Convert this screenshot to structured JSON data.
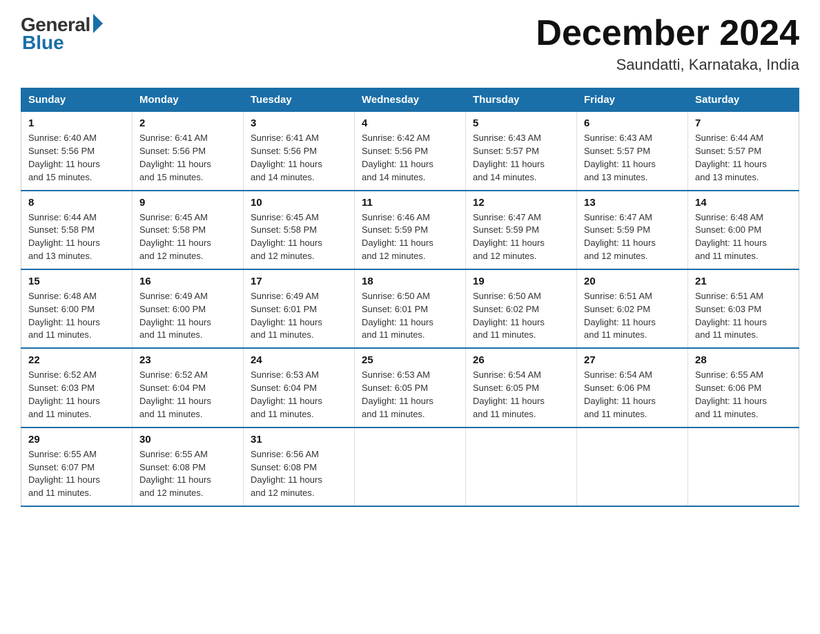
{
  "logo": {
    "general": "General",
    "blue": "Blue"
  },
  "title": "December 2024",
  "subtitle": "Saundatti, Karnataka, India",
  "days_of_week": [
    "Sunday",
    "Monday",
    "Tuesday",
    "Wednesday",
    "Thursday",
    "Friday",
    "Saturday"
  ],
  "weeks": [
    [
      {
        "day": "1",
        "info": "Sunrise: 6:40 AM\nSunset: 5:56 PM\nDaylight: 11 hours\nand 15 minutes."
      },
      {
        "day": "2",
        "info": "Sunrise: 6:41 AM\nSunset: 5:56 PM\nDaylight: 11 hours\nand 15 minutes."
      },
      {
        "day": "3",
        "info": "Sunrise: 6:41 AM\nSunset: 5:56 PM\nDaylight: 11 hours\nand 14 minutes."
      },
      {
        "day": "4",
        "info": "Sunrise: 6:42 AM\nSunset: 5:56 PM\nDaylight: 11 hours\nand 14 minutes."
      },
      {
        "day": "5",
        "info": "Sunrise: 6:43 AM\nSunset: 5:57 PM\nDaylight: 11 hours\nand 14 minutes."
      },
      {
        "day": "6",
        "info": "Sunrise: 6:43 AM\nSunset: 5:57 PM\nDaylight: 11 hours\nand 13 minutes."
      },
      {
        "day": "7",
        "info": "Sunrise: 6:44 AM\nSunset: 5:57 PM\nDaylight: 11 hours\nand 13 minutes."
      }
    ],
    [
      {
        "day": "8",
        "info": "Sunrise: 6:44 AM\nSunset: 5:58 PM\nDaylight: 11 hours\nand 13 minutes."
      },
      {
        "day": "9",
        "info": "Sunrise: 6:45 AM\nSunset: 5:58 PM\nDaylight: 11 hours\nand 12 minutes."
      },
      {
        "day": "10",
        "info": "Sunrise: 6:45 AM\nSunset: 5:58 PM\nDaylight: 11 hours\nand 12 minutes."
      },
      {
        "day": "11",
        "info": "Sunrise: 6:46 AM\nSunset: 5:59 PM\nDaylight: 11 hours\nand 12 minutes."
      },
      {
        "day": "12",
        "info": "Sunrise: 6:47 AM\nSunset: 5:59 PM\nDaylight: 11 hours\nand 12 minutes."
      },
      {
        "day": "13",
        "info": "Sunrise: 6:47 AM\nSunset: 5:59 PM\nDaylight: 11 hours\nand 12 minutes."
      },
      {
        "day": "14",
        "info": "Sunrise: 6:48 AM\nSunset: 6:00 PM\nDaylight: 11 hours\nand 11 minutes."
      }
    ],
    [
      {
        "day": "15",
        "info": "Sunrise: 6:48 AM\nSunset: 6:00 PM\nDaylight: 11 hours\nand 11 minutes."
      },
      {
        "day": "16",
        "info": "Sunrise: 6:49 AM\nSunset: 6:00 PM\nDaylight: 11 hours\nand 11 minutes."
      },
      {
        "day": "17",
        "info": "Sunrise: 6:49 AM\nSunset: 6:01 PM\nDaylight: 11 hours\nand 11 minutes."
      },
      {
        "day": "18",
        "info": "Sunrise: 6:50 AM\nSunset: 6:01 PM\nDaylight: 11 hours\nand 11 minutes."
      },
      {
        "day": "19",
        "info": "Sunrise: 6:50 AM\nSunset: 6:02 PM\nDaylight: 11 hours\nand 11 minutes."
      },
      {
        "day": "20",
        "info": "Sunrise: 6:51 AM\nSunset: 6:02 PM\nDaylight: 11 hours\nand 11 minutes."
      },
      {
        "day": "21",
        "info": "Sunrise: 6:51 AM\nSunset: 6:03 PM\nDaylight: 11 hours\nand 11 minutes."
      }
    ],
    [
      {
        "day": "22",
        "info": "Sunrise: 6:52 AM\nSunset: 6:03 PM\nDaylight: 11 hours\nand 11 minutes."
      },
      {
        "day": "23",
        "info": "Sunrise: 6:52 AM\nSunset: 6:04 PM\nDaylight: 11 hours\nand 11 minutes."
      },
      {
        "day": "24",
        "info": "Sunrise: 6:53 AM\nSunset: 6:04 PM\nDaylight: 11 hours\nand 11 minutes."
      },
      {
        "day": "25",
        "info": "Sunrise: 6:53 AM\nSunset: 6:05 PM\nDaylight: 11 hours\nand 11 minutes."
      },
      {
        "day": "26",
        "info": "Sunrise: 6:54 AM\nSunset: 6:05 PM\nDaylight: 11 hours\nand 11 minutes."
      },
      {
        "day": "27",
        "info": "Sunrise: 6:54 AM\nSunset: 6:06 PM\nDaylight: 11 hours\nand 11 minutes."
      },
      {
        "day": "28",
        "info": "Sunrise: 6:55 AM\nSunset: 6:06 PM\nDaylight: 11 hours\nand 11 minutes."
      }
    ],
    [
      {
        "day": "29",
        "info": "Sunrise: 6:55 AM\nSunset: 6:07 PM\nDaylight: 11 hours\nand 11 minutes."
      },
      {
        "day": "30",
        "info": "Sunrise: 6:55 AM\nSunset: 6:08 PM\nDaylight: 11 hours\nand 12 minutes."
      },
      {
        "day": "31",
        "info": "Sunrise: 6:56 AM\nSunset: 6:08 PM\nDaylight: 11 hours\nand 12 minutes."
      },
      {
        "day": "",
        "info": ""
      },
      {
        "day": "",
        "info": ""
      },
      {
        "day": "",
        "info": ""
      },
      {
        "day": "",
        "info": ""
      }
    ]
  ]
}
